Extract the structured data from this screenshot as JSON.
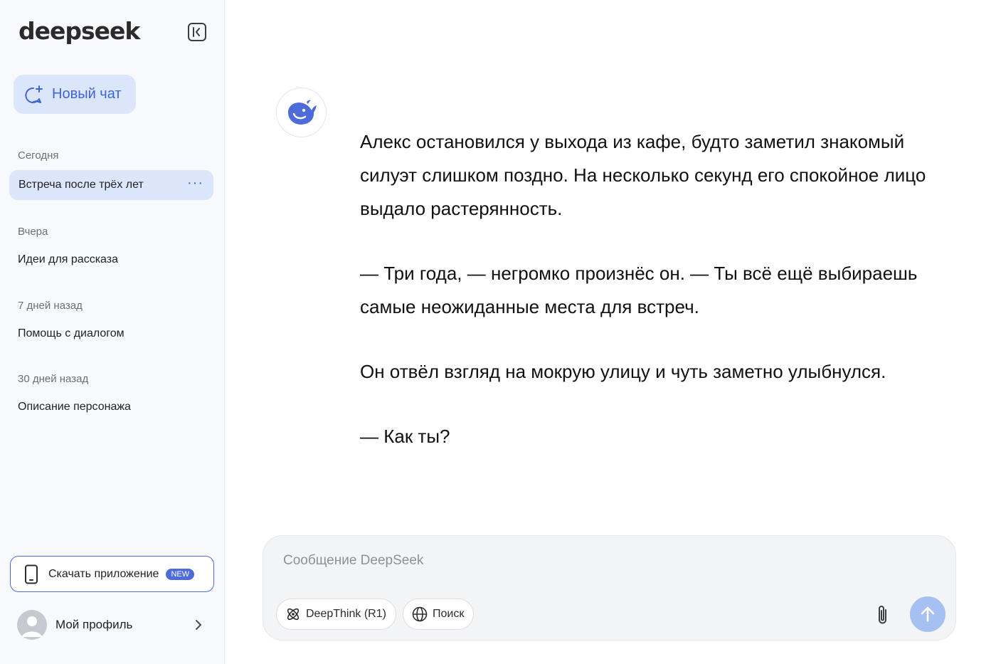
{
  "sidebar": {
    "logo": "deepseek",
    "new_chat_label": "Новый чат",
    "groups": [
      {
        "label": "Сегодня",
        "items": [
          "Встреча после трёх лет"
        ]
      },
      {
        "label": "Вчера",
        "items": [
          "Идеи для рассказа"
        ]
      },
      {
        "label": "7 дней назад",
        "items": [
          "Помощь с диалогом"
        ]
      },
      {
        "label": "30 дней назад",
        "items": [
          "Описание персонажа"
        ]
      }
    ],
    "more_label": "···",
    "download_label": "Скачать приложение",
    "download_badge": "NEW",
    "profile_label": "Мой профиль"
  },
  "conversation": {
    "assistant_icon": "deepseek-whale-icon",
    "paragraphs": [
      "Алекс остановился у выхода из кафе, будто заметил знакомый силуэт слишком поздно. На несколько секунд его спокойное лицо выдало растерянность.",
      "— Три года, — негромко произнёс он. — Ты всё ещё выбираешь самые неожиданные места для встреч.",
      "Он отвёл взгляд на мокрую улицу и чуть заметно улыбнулся.",
      "— Как ты?"
    ]
  },
  "composer": {
    "placeholder": "Сообщение DeepSeek",
    "value": "",
    "deepthink_label": "DeepThink (R1)",
    "search_label": "Поиск"
  },
  "colors": {
    "accent": "#4d6bd9",
    "active_bg": "#dbe6fb",
    "send_disabled": "#a7c0f2"
  }
}
